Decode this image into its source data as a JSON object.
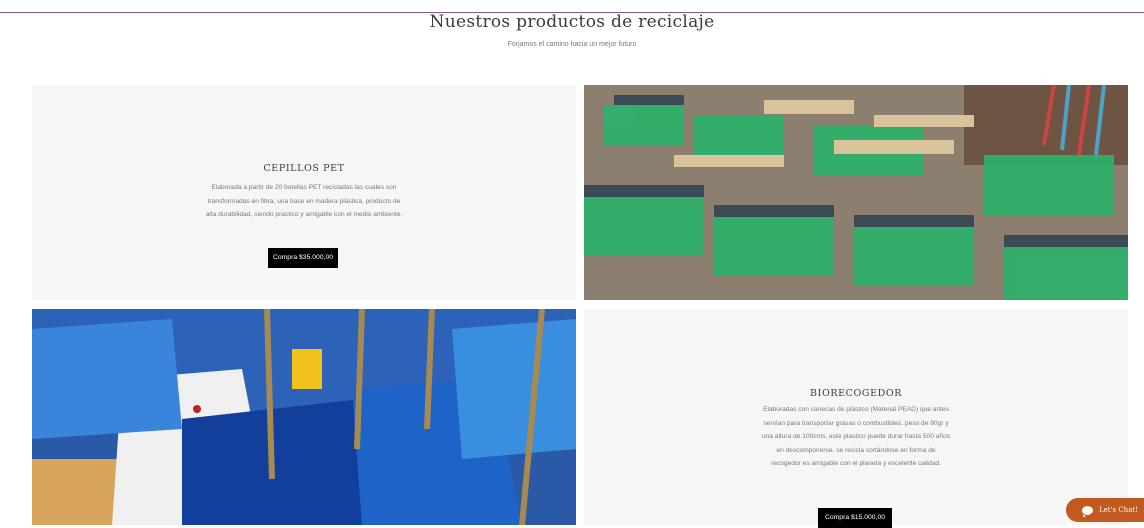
{
  "header": {
    "title": "Nuestros productos de reciclaje",
    "subtitle": "Forjamos el camino hacia un mejor futuro"
  },
  "products": [
    {
      "title": "CEPILLOS PET",
      "description": "Elaborada a partir de 20 botellas PET recicladas las cuales  son transformadas en fibra, una base en madera plástica, producto de alta durabilidad, siendo practico y amigable con el medio ambiente.",
      "button_label": "Compra $35.000,00"
    },
    {
      "title": "BIORECOGEDOR",
      "description": "Elaboradas con canecas de plástico (Material PEAD) que antes servían para transportar grasas o combustibles, peso de 90gr  y una altura de 100cms, este plastico puede durar hasta 500 años en descomponerse, se recicla cortándose en forma de recogedor es amigable con el planeta y excelente calidad.",
      "button_label": "Compra $15.000,00"
    }
  ],
  "chat": {
    "label": "Let's Chat!"
  },
  "colors": {
    "accent": "#c25a1f",
    "panel": "#f6f6f6",
    "button": "#000000"
  }
}
